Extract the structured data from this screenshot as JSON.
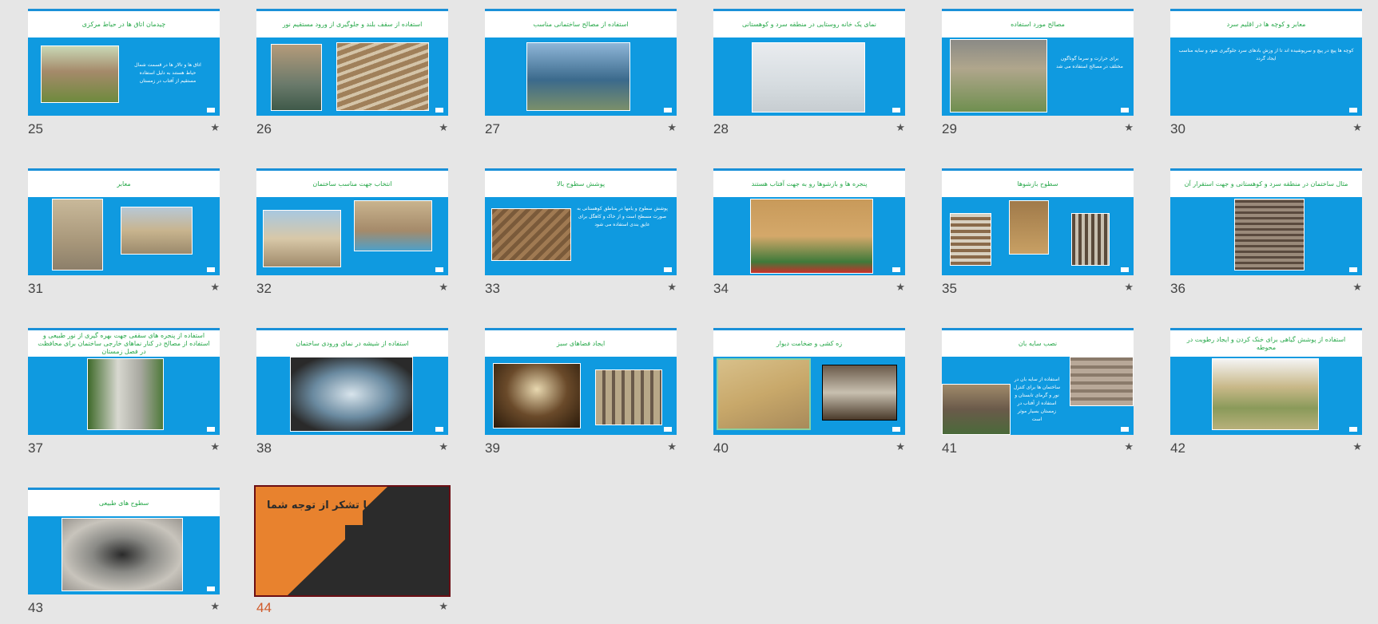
{
  "colors": {
    "background": "#e6e6e6",
    "slide_body": "#0f9ae0",
    "title_text": "#27a84a",
    "active_number": "#d05a2a",
    "final_slide_orange": "#e8822e",
    "final_slide_dark": "#2b2b2b"
  },
  "star_icon": "★",
  "slides": [
    {
      "number": "25",
      "title": "چیدمان اتاق ها در حیاط مرکزی",
      "body": "اتاق ها و تالار ها در قسمت شمال حیاط هستند به دلیل استفاده مستقیم از آفتاب در زمستان"
    },
    {
      "number": "26",
      "title": "استفاده از سقف بلند و جلوگیری از ورود مستقیم نور",
      "body": ""
    },
    {
      "number": "27",
      "title": "استفاده از مصالح ساختمانی مناسب",
      "body": ""
    },
    {
      "number": "28",
      "title": "نمای یک خانه روستایی در منطقه سرد و کوهستانی",
      "body": ""
    },
    {
      "number": "29",
      "title": "مصالح مورد استفاده",
      "body": "برای حرارت و سرما گوناگون مختلف در مصالح استفاده می شد"
    },
    {
      "number": "30",
      "title": "معابر و کوچه ها در اقلیم سرد",
      "body": "کوچه ها پیچ در پیچ و سرپوشیده اند تا از وزش بادهای سرد جلوگیری شود و سایه مناسب ایجاد گردد"
    },
    {
      "number": "31",
      "title": "معابر",
      "body": ""
    },
    {
      "number": "32",
      "title": "انتخاب جهت مناسب ساختمان",
      "body": ""
    },
    {
      "number": "33",
      "title": "پوشش سطوح بالا",
      "body": "پوشش سطوح و بامها در مناطق کوهستانی به صورت مسطح است و از خاک و کاهگل برای عایق بندی استفاده می شود"
    },
    {
      "number": "34",
      "title": "پنجره ها و بازشوها رو به جهت آفتاب هستند",
      "body": ""
    },
    {
      "number": "35",
      "title": "سطوح بازشوها",
      "body": ""
    },
    {
      "number": "36",
      "title": "مثال ساختمان در منطقه سرد و کوهستانی و جهت استقرار آن",
      "body": ""
    },
    {
      "number": "37",
      "title": "استفاده از پنجره های سقفی جهت بهره گیری از نور طبیعی و استفاده از مصالح در کنار نماهای خارجی ساختمان برای محافظت در فصل زمستان",
      "body": ""
    },
    {
      "number": "38",
      "title": "استفاده از شیشه در نمای ورودی ساختمان",
      "body": ""
    },
    {
      "number": "39",
      "title": "ایجاد فضاهای سبز",
      "body": ""
    },
    {
      "number": "40",
      "title": "زه کشی و ضخامت دیوار",
      "body": ""
    },
    {
      "number": "41",
      "title": "نصب سایه بان",
      "body": "استفاده از سایه بان در ساختمان ها برای کنترل نور و گرمای تابستان و استفاده از آفتاب در زمستان بسیار موثر است"
    },
    {
      "number": "42",
      "title": "استفاده از پوشش گیاهی برای خنک کردن و ایجاد رطوبت در محوطه",
      "body": ""
    },
    {
      "number": "43",
      "title": "سطوح های طبیعی",
      "body": ""
    },
    {
      "number": "44",
      "title": "با تشکر از توجه شما",
      "body": ""
    }
  ]
}
